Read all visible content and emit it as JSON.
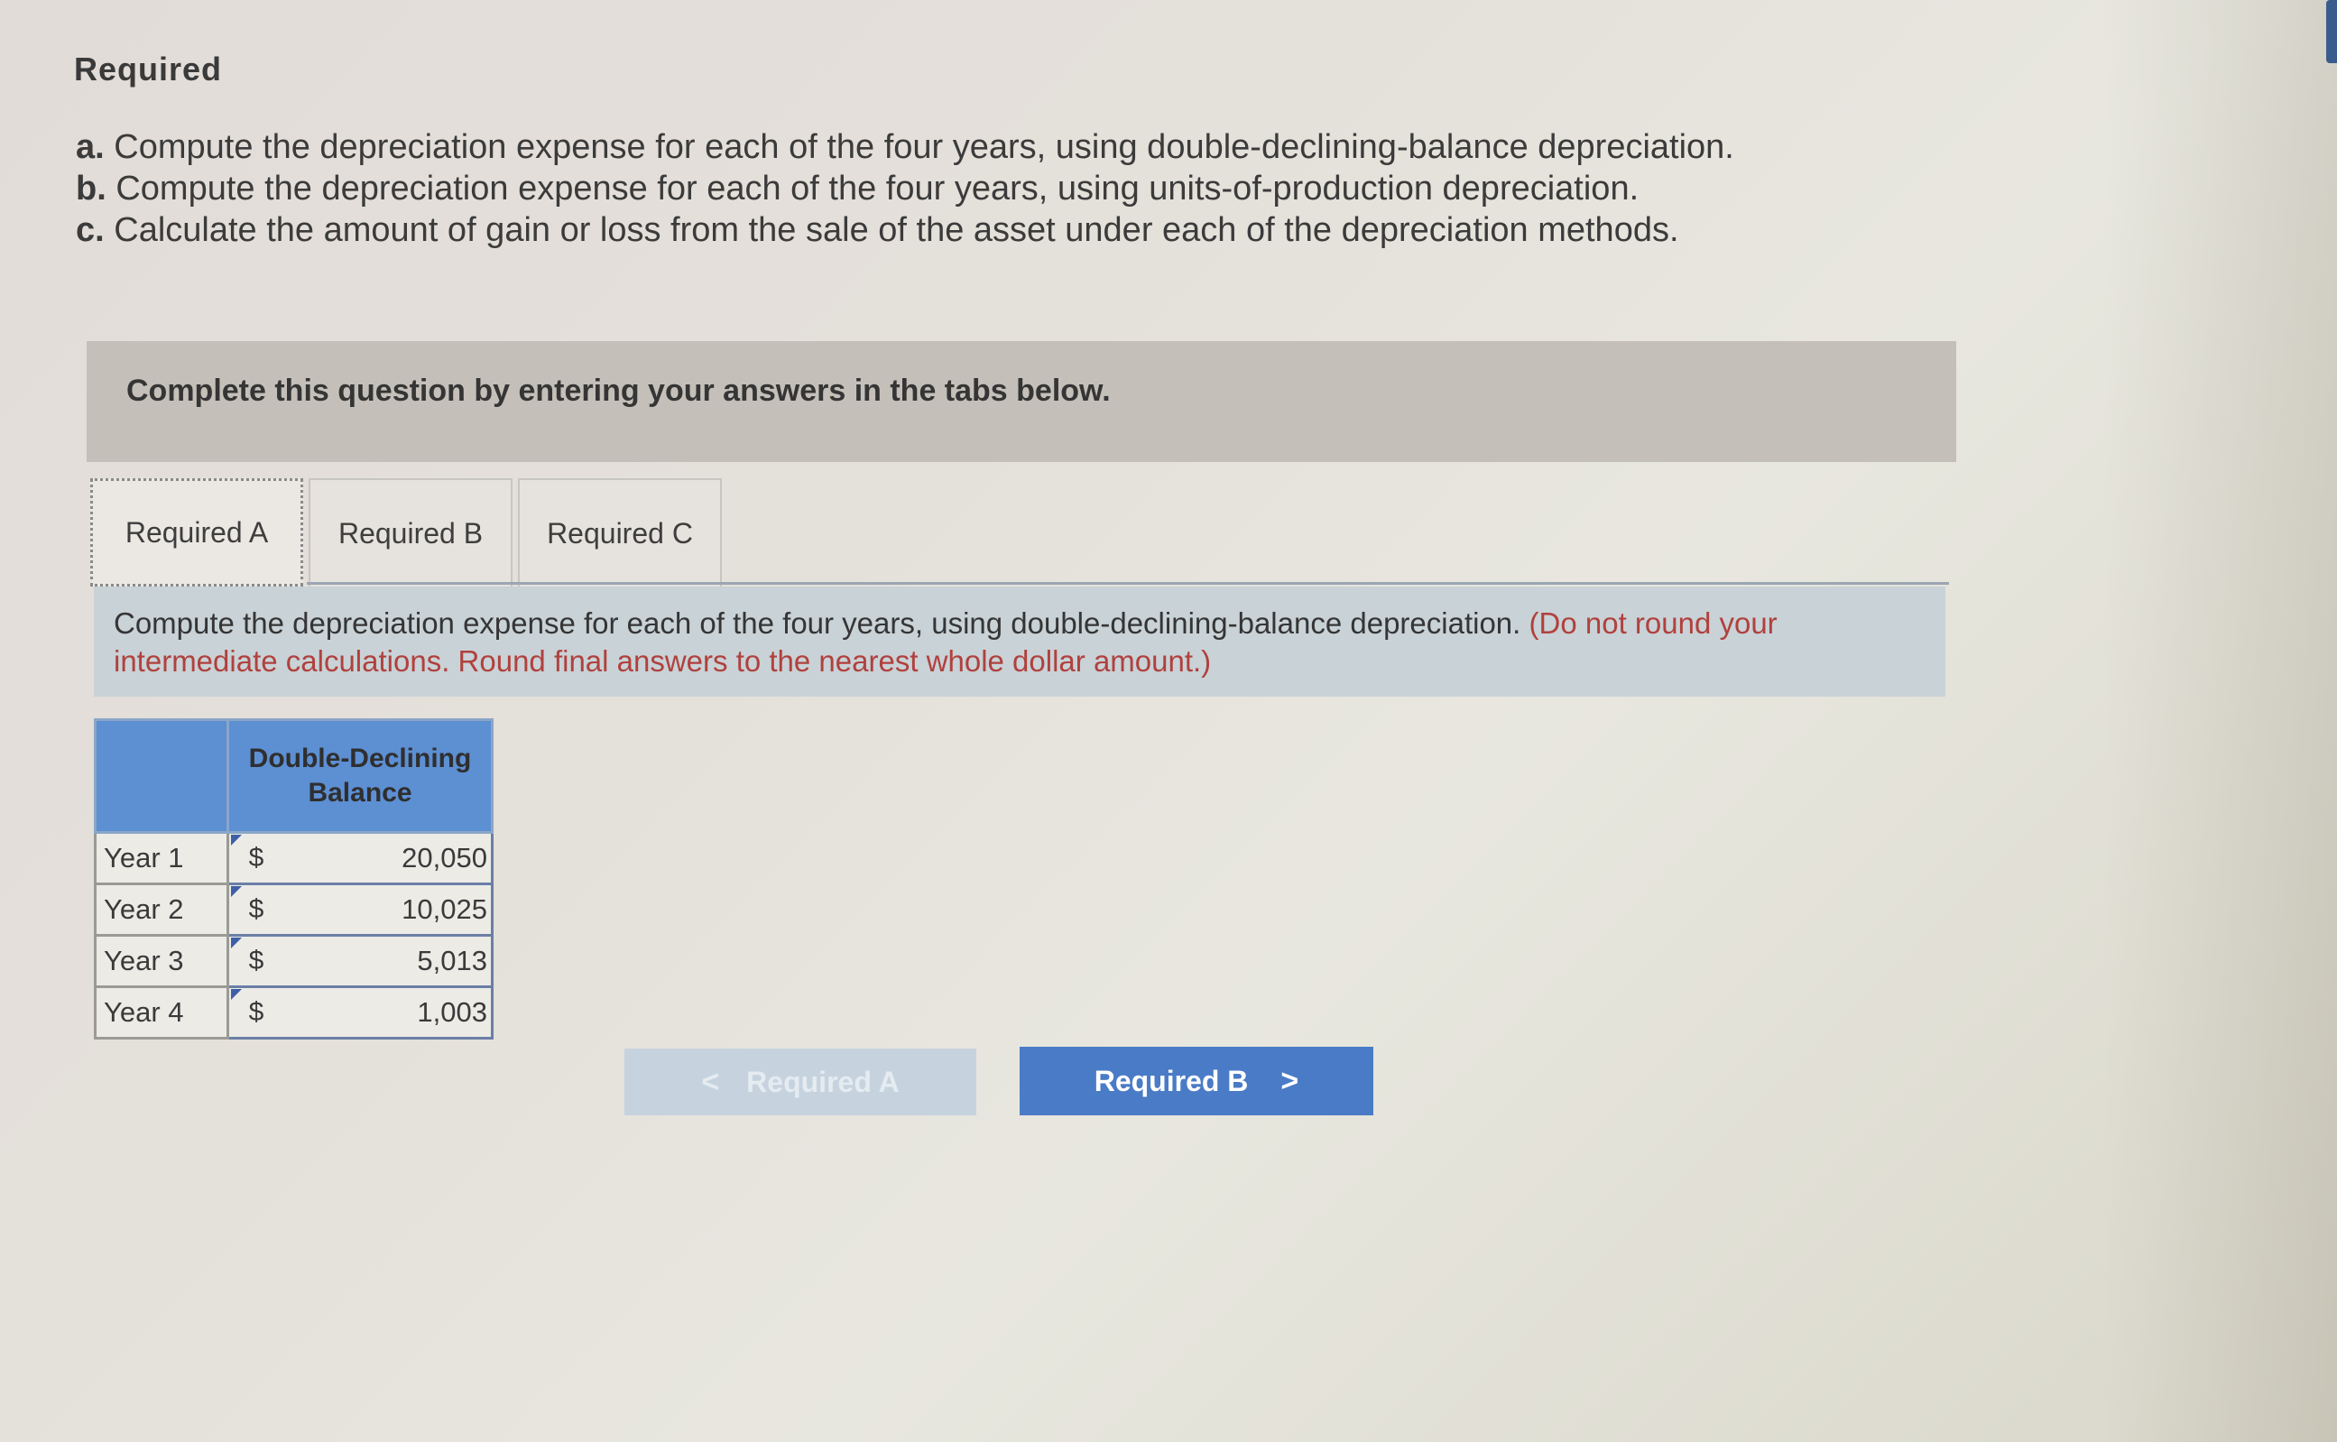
{
  "section": {
    "title": "Required"
  },
  "requirements": [
    {
      "letter": "a.",
      "text": "Compute the depreciation expense for each of the four years, using double-declining-balance depreciation."
    },
    {
      "letter": "b.",
      "text": "Compute the depreciation expense for each of the four years, using units-of-production depreciation."
    },
    {
      "letter": "c.",
      "text": "Calculate the amount of gain or loss from the sale of the asset under each of the depreciation methods."
    }
  ],
  "instruction_banner": "Complete this question by entering your answers in the tabs below.",
  "tabs": [
    {
      "label": "Required A",
      "active": true
    },
    {
      "label": "Required B",
      "active": false
    },
    {
      "label": "Required C",
      "active": false
    }
  ],
  "question": {
    "text": "Compute the depreciation expense for each of the four years, using double-declining-balance depreciation.",
    "note": "(Do not round your intermediate calculations. Round final answers to the nearest whole dollar amount.)"
  },
  "table": {
    "column_header_line1": "Double-Declining",
    "column_header_line2": "Balance",
    "rows": [
      {
        "label": "Year 1",
        "currency": "$",
        "value": "20,050"
      },
      {
        "label": "Year 2",
        "currency": "$",
        "value": "10,025"
      },
      {
        "label": "Year 3",
        "currency": "$",
        "value": "5,013"
      },
      {
        "label": "Year 4",
        "currency": "$",
        "value": "1,003"
      }
    ]
  },
  "navigation": {
    "prev_label": "Required A",
    "next_label": "Required B",
    "prev_chevron": "<",
    "next_chevron": ">"
  },
  "colors": {
    "table_header": "#5d8fd3",
    "next_button": "#4a7bc6",
    "prev_button_disabled": "#c6d3df",
    "note_text": "#b0413e",
    "question_bg": "#c9d2d6",
    "banner_bg": "#c4c0b9"
  }
}
